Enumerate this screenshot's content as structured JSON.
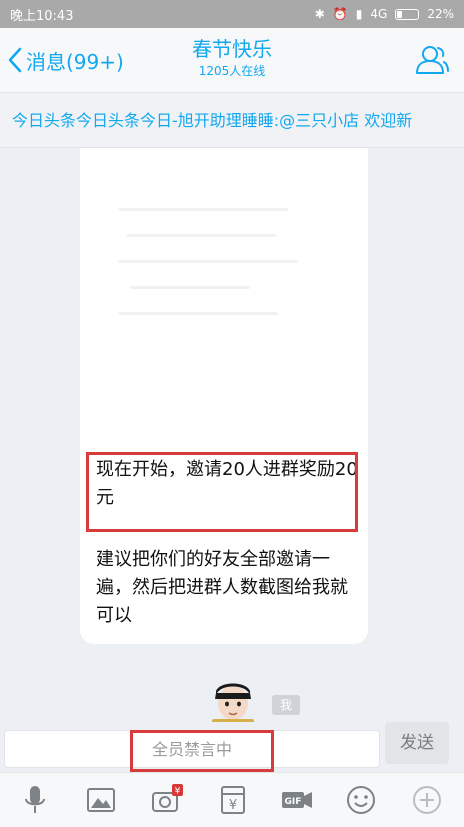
{
  "status_bar": {
    "time": "晚上10:43",
    "network": "4G",
    "battery": "22%"
  },
  "header": {
    "back_label": "消息(99+)",
    "title": "春节快乐",
    "subtitle": "1205人在线"
  },
  "notice": {
    "text": "今日头条今日头条今日-旭开助理睡睡:@三只小店 欢迎新"
  },
  "messages": {
    "msg1": "现在开始，邀请20人进群奖励20元",
    "msg2": "建议把你们的好友全部邀请一遍，然后把进群人数截图给我就可以"
  },
  "me_tag": "我",
  "input": {
    "placeholder": "全员禁言中",
    "send_label": "发送"
  },
  "toolbar": {
    "gif_label": "GIF",
    "red_packet_badge": "¥",
    "wallet_symbol": "¥"
  },
  "colors": {
    "accent": "#12a8f0",
    "highlight_box": "#d83b3b"
  }
}
